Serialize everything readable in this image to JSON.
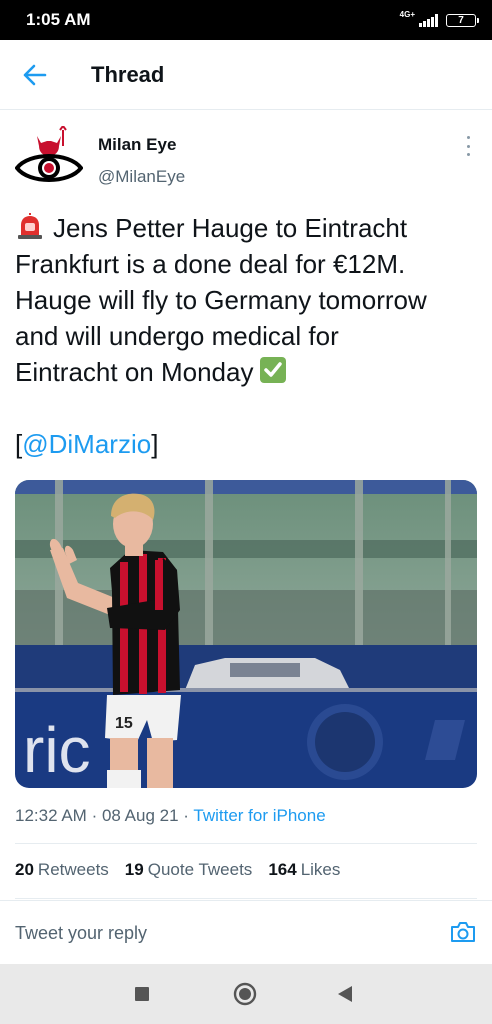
{
  "status_bar": {
    "time": "1:05 AM",
    "network": "4G+",
    "battery": "7"
  },
  "header": {
    "title": "Thread"
  },
  "tweet": {
    "author_name": "Milan Eye",
    "author_handle": "@MilanEye",
    "text_line_1": "Jens Petter Hauge to Eintracht",
    "text_line_2": "Frankfurt is a done deal for €12M.",
    "text_line_3": "Hauge will fly to Germany tomorrow",
    "text_line_4": "and will undergo medical for",
    "text_line_5": "Eintracht on Monday",
    "mention_open": "[",
    "mention": "@DiMarzio",
    "mention_close": "]",
    "media_text": "ric",
    "time": "12:32 AM",
    "date": "08 Aug 21",
    "source": "Twitter for iPhone",
    "separator": "·"
  },
  "stats": {
    "retweets_count": "20",
    "retweets_label": "Retweets",
    "quotes_count": "19",
    "quotes_label": "Quote Tweets",
    "likes_count": "164",
    "likes_label": "Likes"
  },
  "reply": {
    "placeholder": "Tweet your reply"
  },
  "icons": {
    "back": "arrow-left-icon",
    "more": "more-vertical-icon",
    "camera": "camera-icon",
    "siren": "siren-emoji",
    "check": "check-mark-emoji"
  },
  "colors": {
    "accent": "#1d9bf0",
    "secondary_text": "#536471",
    "kit_red": "#c8102e"
  }
}
